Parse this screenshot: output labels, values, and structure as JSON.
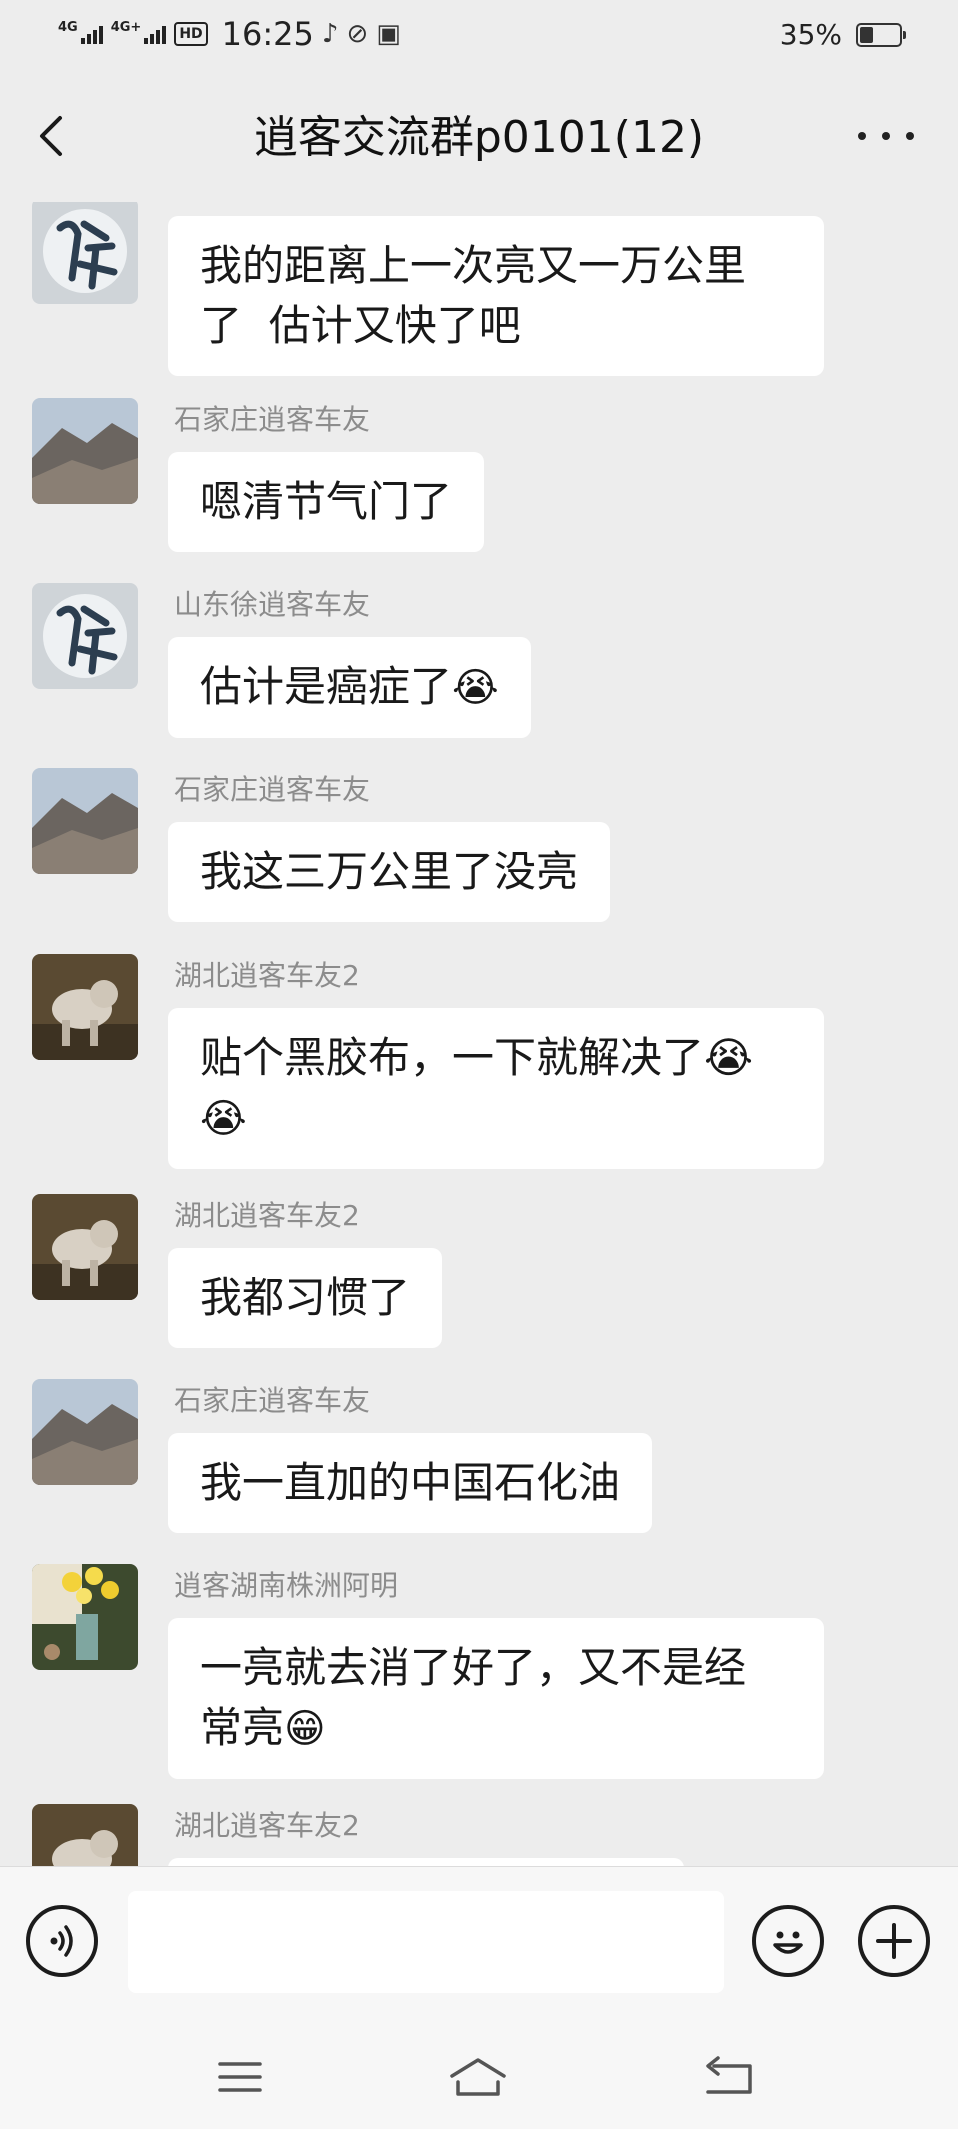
{
  "status_bar": {
    "net1": "4G",
    "net2": "4G+",
    "hd": "HD",
    "time": "16:25",
    "battery_pct": "35%",
    "battery_level": 0.35
  },
  "header": {
    "title": "逍客交流群p0101(12)",
    "back_icon": "chevron-left-icon",
    "more_icon": "more-dots-icon"
  },
  "messages": [
    {
      "sender": "",
      "avatar": "calligraphy-xu",
      "lines": "我的距离上一次亮又一万公里\n了  估计又快了吧",
      "emoji": ""
    },
    {
      "sender": "石家庄逍客车友",
      "avatar": "mountain",
      "lines": "嗯清节气门了",
      "emoji": ""
    },
    {
      "sender": "山东徐逍客车友",
      "avatar": "calligraphy-xu",
      "lines": "估计是癌症了",
      "emoji": "😭"
    },
    {
      "sender": "石家庄逍客车友",
      "avatar": "mountain",
      "lines": "我这三万公里了没亮",
      "emoji": ""
    },
    {
      "sender": "湖北逍客车友2",
      "avatar": "dog",
      "lines": "贴个黑胶布，一下就解决了😭\n",
      "emoji": "😭"
    },
    {
      "sender": "湖北逍客车友2",
      "avatar": "dog",
      "lines": "我都习惯了",
      "emoji": ""
    },
    {
      "sender": "石家庄逍客车友",
      "avatar": "mountain",
      "lines": "我一直加的中国石化油",
      "emoji": ""
    },
    {
      "sender": "逍客湖南株洲阿明",
      "avatar": "flowers",
      "lines": "一亮就去消了好了，又不是经\n常亮",
      "emoji": "😁"
    },
    {
      "sender": "湖北逍客车友2",
      "avatar": "dog",
      "lines": "",
      "emoji": ""
    }
  ],
  "input_bar": {
    "voice_icon": "voice-icon",
    "emoji_icon": "emoji-face-icon",
    "plus_icon": "plus-icon",
    "placeholder": ""
  },
  "nav_bar": {
    "menu_icon": "menu-icon",
    "home_icon": "home-icon",
    "back_icon": "back-arrow-icon"
  }
}
